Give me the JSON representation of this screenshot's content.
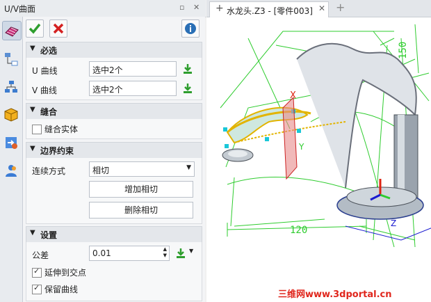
{
  "panel": {
    "title": "U/V曲面",
    "accent": "#2a6fb5"
  },
  "sections": {
    "required": {
      "header": "必选",
      "u_label": "U 曲线",
      "u_value": "选中2个",
      "v_label": "V 曲线",
      "v_value": "选中2个"
    },
    "stitch": {
      "header": "缝合",
      "stitch_solid": "缝合实体"
    },
    "boundary": {
      "header": "边界约束",
      "continuity_label": "连续方式",
      "continuity_value": "相切",
      "add_tangent": "增加相切",
      "remove_tangent": "删除相切"
    },
    "settings": {
      "header": "设置",
      "tolerance_label": "公差",
      "tolerance_value": "0.01",
      "extend_label": "延伸到交点",
      "keep_curves_label": "保留曲线"
    }
  },
  "tabs": [
    {
      "label": "水龙头.Z3 - [零件003]"
    }
  ],
  "viewport": {
    "dim_120": "120",
    "dim_150": "150",
    "axis_x": "X",
    "axis_y": "Y",
    "axis_z": "Z"
  },
  "watermark": "三维网www.3dportal.cn",
  "icons": [
    "ok-check-icon",
    "cancel-x-icon",
    "info-icon",
    "pick-icon",
    "surface-icon",
    "tree-icon",
    "hierarchy-icon",
    "cube-icon",
    "import-icon",
    "user-icon",
    "pin-icon",
    "close-icon",
    "plus-icon",
    "dropdown-icon",
    "spinner-icon"
  ]
}
